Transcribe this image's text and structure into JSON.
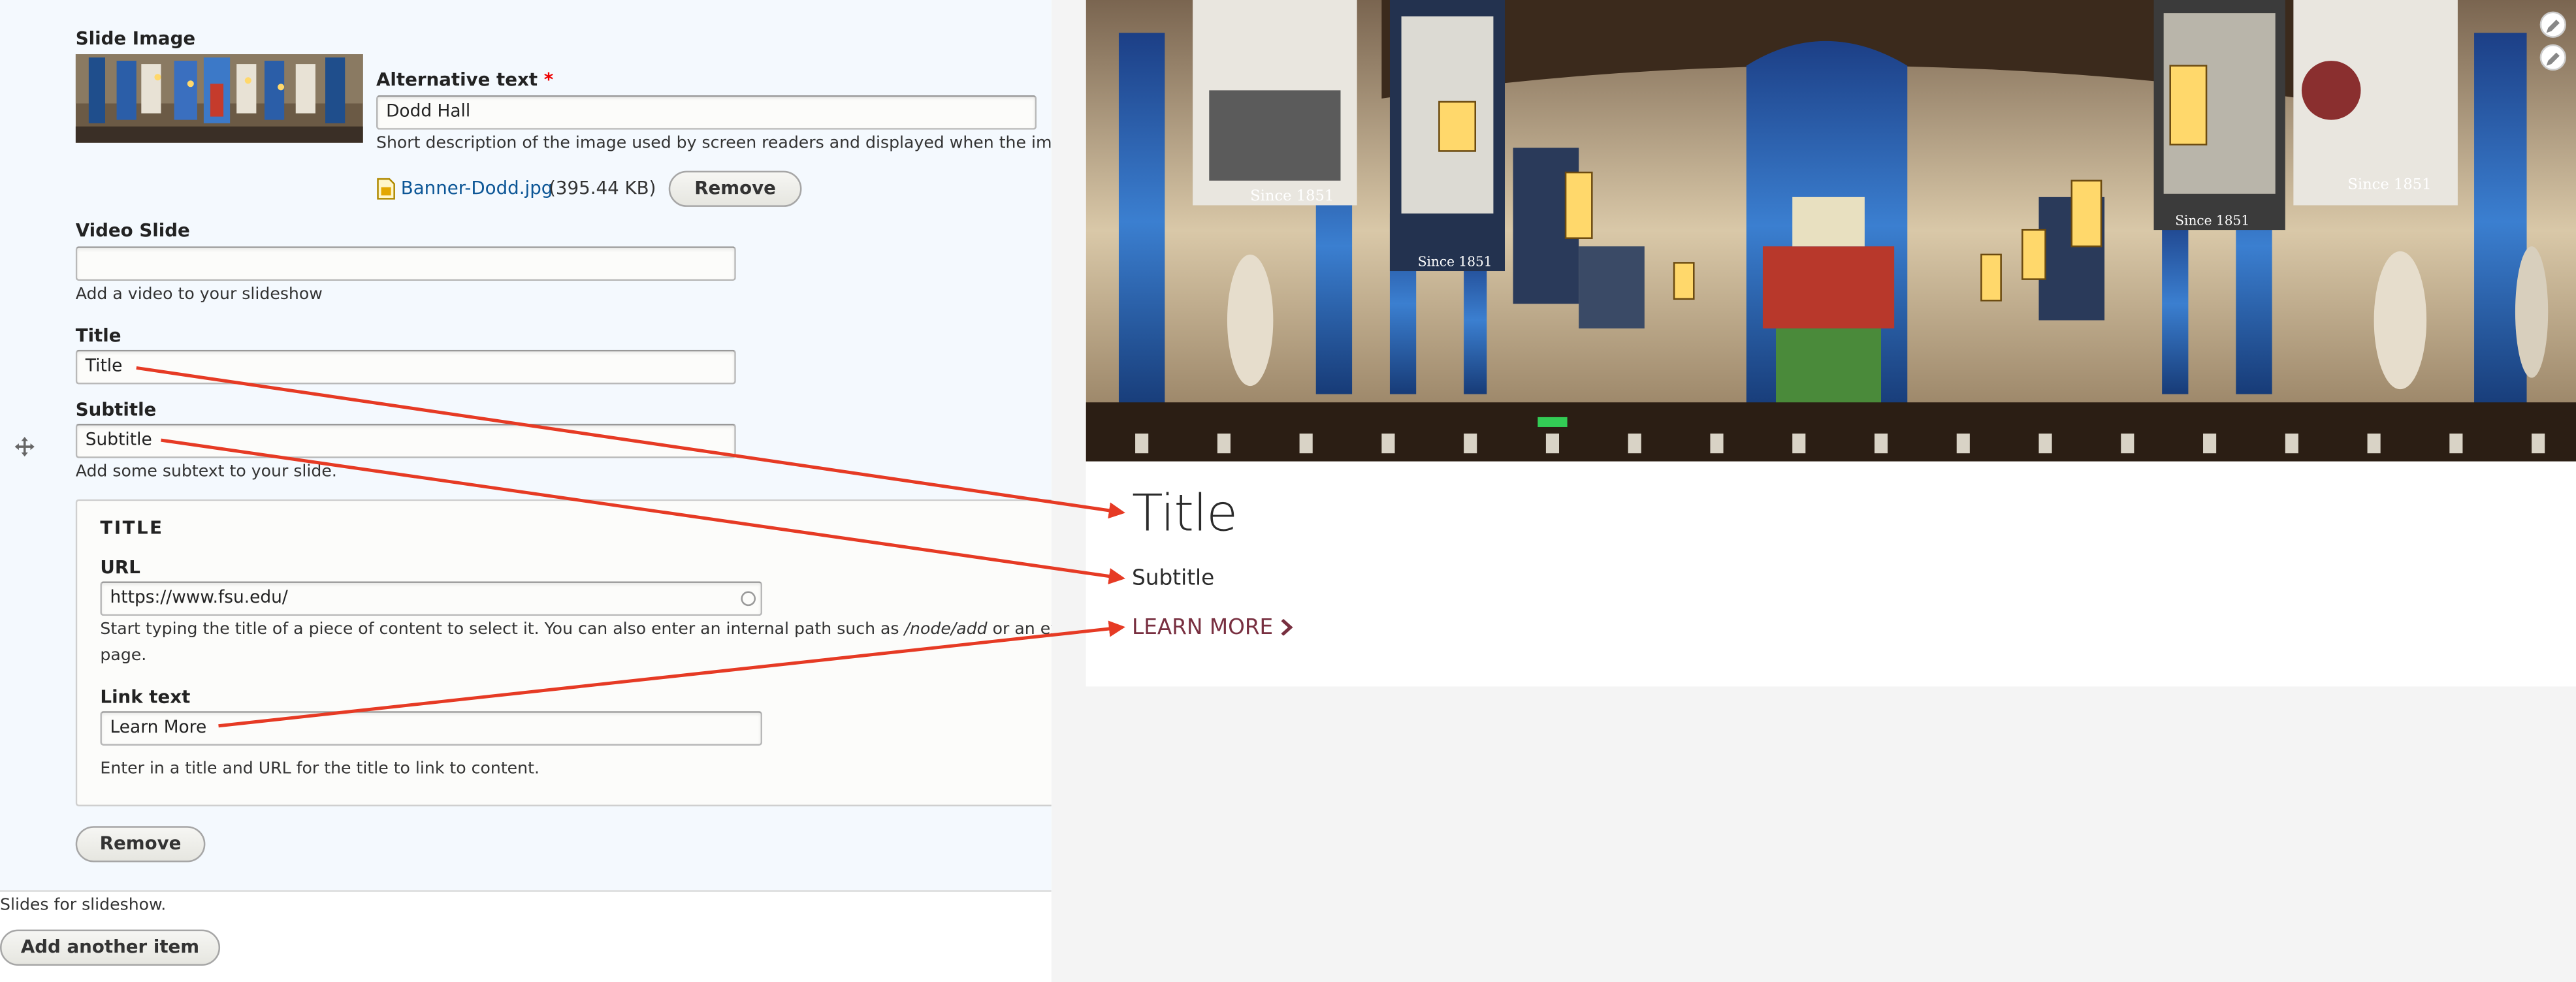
{
  "form": {
    "slide_image": {
      "label": "Slide Image",
      "alt_label": "Alternative text",
      "required_mark": "*",
      "alt_value": "Dodd Hall",
      "alt_description": "Short description of the image used by screen readers and displayed when the image i",
      "file_name": "Banner-Dodd.jpg",
      "file_size": "(395.44 KB)",
      "remove_label": "Remove",
      "file_icon": "image-file-icon"
    },
    "video": {
      "label": "Video Slide",
      "value": "",
      "description": "Add a video to your slideshow"
    },
    "title": {
      "label": "Title",
      "value": "Title"
    },
    "subtitle": {
      "label": "Subtitle",
      "value": "Subtitle",
      "description": "Add some subtext to your slide."
    },
    "link_group": {
      "legend": "TITLE",
      "url_label": "URL",
      "url_value": "https://www.fsu.edu/",
      "url_help_1": "Start typing the title of a piece of content to select it. You can also enter an internal path such as ",
      "url_help_em": "/node/add",
      "url_help_2": " or an extern",
      "url_help_3": "page.",
      "link_text_label": "Link text",
      "link_text_value": "Learn More",
      "description": "Enter in a title and URL for the title to link to content."
    },
    "remove_slide_label": "Remove",
    "drag_icon": "drag-handle-icon",
    "slides_description": "Slides for slideshow.",
    "add_another_label": "Add another item"
  },
  "preview": {
    "title": "Title",
    "subtitle": "Subtitle",
    "link_label": "LEARN MORE",
    "link_icon": "chevron-right-icon",
    "banner_years": [
      "Since 1851",
      "Since 1851",
      "Since 1851",
      "Since 1851"
    ],
    "edit_icons": [
      "pencil-icon",
      "pencil-icon"
    ]
  },
  "colors": {
    "annotation_arrow": "#e63a24",
    "link": "#782f40",
    "file_link": "#0c5696",
    "panel_bg": "#f4f9fe",
    "preview_bg": "#f4f4f4"
  }
}
